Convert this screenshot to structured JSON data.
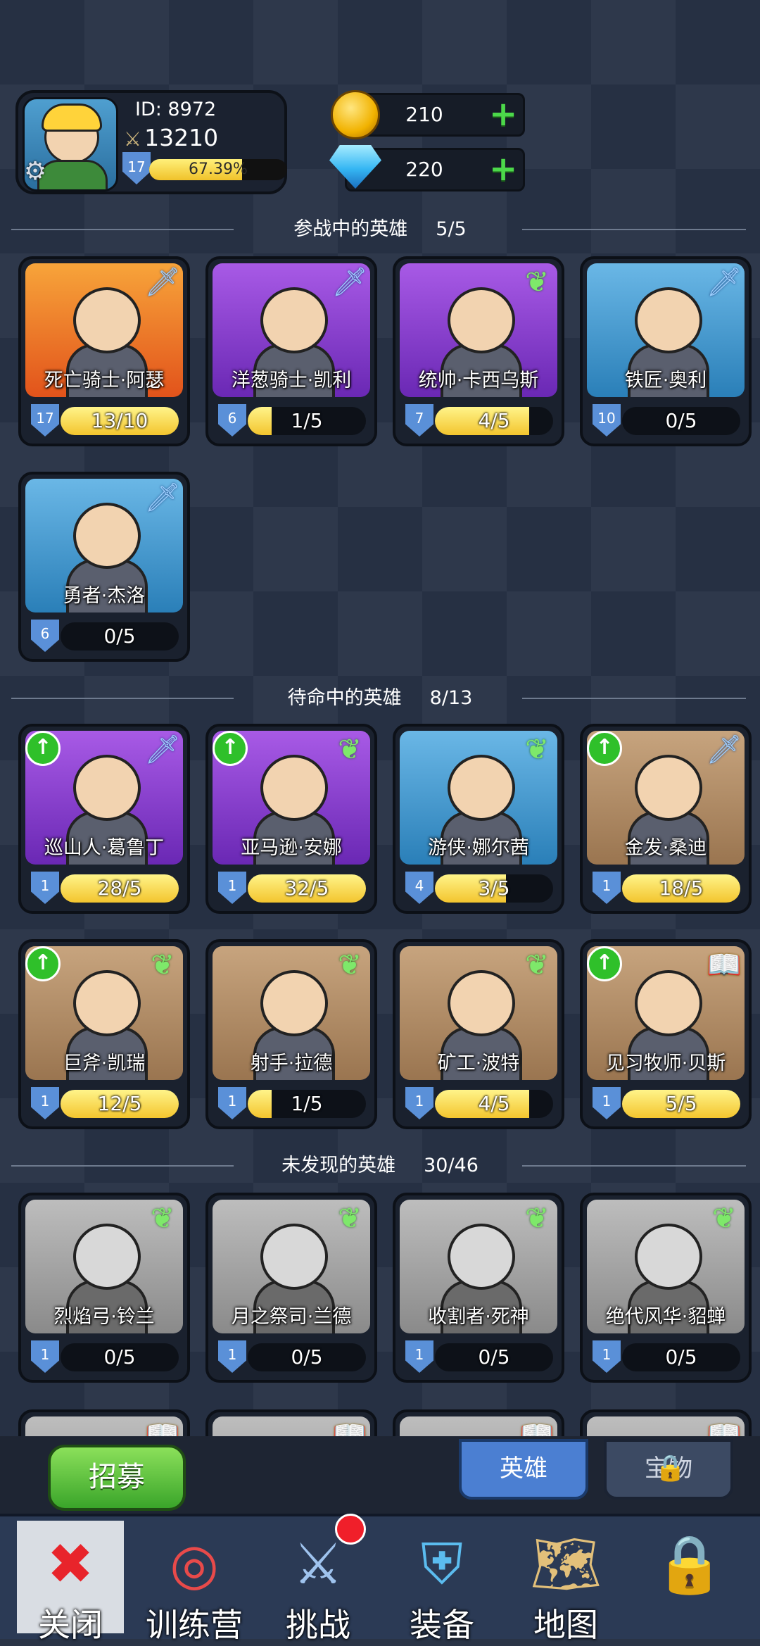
{
  "profile": {
    "id": "ID: 8972",
    "power": "13210",
    "level": "17",
    "xp_text": "67.39%",
    "xp_fraction": 0.6739
  },
  "currency": {
    "gold": "210",
    "gems": "220"
  },
  "sections": {
    "active": {
      "title": "参战中的英雄",
      "count": "5/5"
    },
    "standby": {
      "title": "待命中的英雄",
      "count": "8/13"
    },
    "undiscovered": {
      "title": "未发现的英雄",
      "count": "30/46"
    }
  },
  "active_heroes": [
    {
      "name": "死亡骑士·阿瑟",
      "level": "17",
      "progress": "13/10",
      "fill": 1.0,
      "role": "sword-icon",
      "color": "#f08a2e"
    },
    {
      "name": "洋葱骑士·凯利",
      "level": "6",
      "progress": "1/5",
      "fill": 0.2,
      "role": "sword-icon",
      "color": "#8a3fd0"
    },
    {
      "name": "统帅·卡西乌斯",
      "level": "7",
      "progress": "4/5",
      "fill": 0.8,
      "role": "wing-icon",
      "color": "#8a3fd0"
    },
    {
      "name": "铁匠·奥利",
      "level": "10",
      "progress": "0/5",
      "fill": 0.0,
      "role": "sword-icon",
      "color": "#4a9ed4"
    },
    {
      "name": "勇者·杰洛",
      "level": "6",
      "progress": "0/5",
      "fill": 0.0,
      "role": "sword-icon",
      "color": "#4a9ed4"
    }
  ],
  "standby_heroes": [
    {
      "name": "巡山人·葛鲁丁",
      "level": "1",
      "progress": "28/5",
      "fill": 1.0,
      "role": "sword-icon",
      "upgrade": true
    },
    {
      "name": "亚马逊·安娜",
      "level": "1",
      "progress": "32/5",
      "fill": 1.0,
      "role": "wing-icon",
      "upgrade": true
    },
    {
      "name": "游侠·娜尔茜",
      "level": "4",
      "progress": "3/5",
      "fill": 0.6,
      "role": "wing-icon",
      "upgrade": false
    },
    {
      "name": "金发·桑迪",
      "level": "1",
      "progress": "18/5",
      "fill": 1.0,
      "role": "sword-icon",
      "upgrade": true
    },
    {
      "name": "巨斧·凯瑞",
      "level": "1",
      "progress": "12/5",
      "fill": 1.0,
      "role": "wing-icon",
      "upgrade": true
    },
    {
      "name": "射手·拉德",
      "level": "1",
      "progress": "1/5",
      "fill": 0.2,
      "role": "wing-icon",
      "upgrade": false
    },
    {
      "name": "矿工·波特",
      "level": "1",
      "progress": "4/5",
      "fill": 0.8,
      "role": "wing-icon",
      "upgrade": false
    },
    {
      "name": "见习牧师·贝斯",
      "level": "1",
      "progress": "5/5",
      "fill": 1.0,
      "role": "book-icon",
      "upgrade": true
    }
  ],
  "undiscovered_heroes": [
    {
      "name": "烈焰弓·铃兰",
      "level": "1",
      "progress": "0/5",
      "role": "wing-icon"
    },
    {
      "name": "月之祭司·兰德",
      "level": "1",
      "progress": "0/5",
      "role": "wing-icon"
    },
    {
      "name": "收割者·死神",
      "level": "1",
      "progress": "0/5",
      "role": "wing-icon"
    },
    {
      "name": "绝代风华·貂蝉",
      "level": "1",
      "progress": "0/5",
      "role": "wing-icon"
    }
  ],
  "bottom": {
    "recruit_label": "招募",
    "tab_heroes": "英雄",
    "tab_locked": "宝物",
    "nav": [
      {
        "label": "关闭",
        "icon": "close-icon"
      },
      {
        "label": "训练营",
        "icon": "target-icon"
      },
      {
        "label": "挑战",
        "icon": "shield-sword-icon"
      },
      {
        "label": "装备",
        "icon": "armor-icon"
      },
      {
        "label": "地图",
        "icon": "map-icon"
      },
      {
        "label": "",
        "icon": "locked-icon"
      }
    ]
  }
}
